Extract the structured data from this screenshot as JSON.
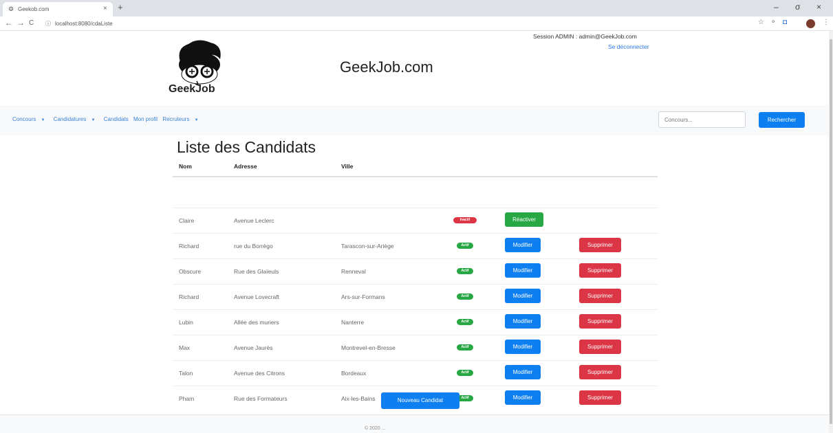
{
  "browser": {
    "tab_title": "Geekob.com",
    "tab_close": "×",
    "new_tab": "+",
    "url": "localhost:8080/cdaListe",
    "back": "←",
    "forward": "→",
    "reload": "C",
    "minimize": "–",
    "restore": "σ",
    "close": "×",
    "favicon": "⚙",
    "lock": "ⓘ",
    "star": "☆",
    "ext1": "⚬",
    "ext2": "◘",
    "menu": "⋮"
  },
  "header": {
    "logo_text": "GeekJob",
    "site_title": "GeekJob.com",
    "session_text": "Session ADMIN : admin@GeekJob.com",
    "logout": "Se déconnecter"
  },
  "nav": {
    "items": [
      {
        "label": "Concours",
        "caret": "▼"
      },
      {
        "label": "Candidatures",
        "caret": "▼"
      },
      {
        "label": "Candidats",
        "caret": ""
      },
      {
        "label": "Mon profil",
        "caret": ""
      },
      {
        "label": "Recruteurs",
        "caret": "▼"
      }
    ],
    "search_placeholder": "Concours...",
    "search_button": "Rechercher"
  },
  "main": {
    "title": "Liste des Candidats",
    "columns": [
      "Nom",
      "Adresse",
      "Ville"
    ],
    "rows": [
      {
        "nom": "Claire",
        "adresse": "Avenue Leclerc",
        "ville": "",
        "status": "Inactif",
        "active": false,
        "action": "Réactiver",
        "delete": ""
      },
      {
        "nom": "Richard",
        "adresse": "rue du Borrègo",
        "ville": "Tarascon-sur-Ariège",
        "status": "Actif",
        "active": true,
        "action": "Modifier",
        "delete": "Supprimer"
      },
      {
        "nom": "Obscure",
        "adresse": "Rue des Glaïeuls",
        "ville": "Renneval",
        "status": "Actif",
        "active": true,
        "action": "Modifier",
        "delete": "Supprimer"
      },
      {
        "nom": "Richard",
        "adresse": "Avenue Lovecraft",
        "ville": "Ars-sur-Formans",
        "status": "Actif",
        "active": true,
        "action": "Modifier",
        "delete": "Supprimer"
      },
      {
        "nom": "Lubin",
        "adresse": "Allée des muriers",
        "ville": "Nanterre",
        "status": "Actif",
        "active": true,
        "action": "Modifier",
        "delete": "Supprimer"
      },
      {
        "nom": "Max",
        "adresse": "Avenue Jaurès",
        "ville": "Montrevel-en-Bresse",
        "status": "Actif",
        "active": true,
        "action": "Modifier",
        "delete": "Supprimer"
      },
      {
        "nom": "Talon",
        "adresse": "Avenue des Citrons",
        "ville": "Bordeaux",
        "status": "Actif",
        "active": true,
        "action": "Modifier",
        "delete": "Supprimer"
      },
      {
        "nom": "Pham",
        "adresse": "Rue des Formateurs",
        "ville": "Aix-les-Bains",
        "status": "Actif",
        "active": true,
        "action": "Modifier",
        "delete": "Supprimer"
      }
    ],
    "new_button": "Nouveau Candidat"
  },
  "footer": {
    "text": "© 2020 ..."
  },
  "colors": {
    "primary": "#0d7ff0",
    "danger": "#dc3545",
    "success": "#28a745",
    "link": "#3a82d8"
  }
}
